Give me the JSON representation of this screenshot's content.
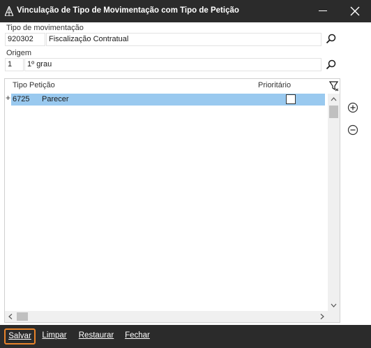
{
  "window": {
    "title": "Vinculação de Tipo de Movimentação com Tipo de Petição",
    "icons": {
      "app": "app-logo-icon",
      "minimize": "minimize-icon",
      "close": "close-icon"
    }
  },
  "movimentacao": {
    "label": "Tipo de movimentação",
    "code": "920302",
    "description": "Fiscalização Contratual",
    "lookup_icon": "search-icon"
  },
  "origem": {
    "label": "Origem",
    "code": "1",
    "description": "1º grau",
    "lookup_icon": "search-icon"
  },
  "grid": {
    "columns": {
      "tipo": "Tipo Petição",
      "prioritario": "Prioritário"
    },
    "filter_icon": "filter-icon",
    "rows": [
      {
        "expander": "+",
        "code": "6725",
        "description": "Parecer",
        "prioritario": false,
        "selected": true
      }
    ]
  },
  "side_actions": {
    "add_icon": "add-row-icon",
    "remove_icon": "remove-row-icon"
  },
  "footer": {
    "save_label": "Salvar",
    "clear_label": "Limpar",
    "restore_label": "Restaurar",
    "close_label": "Fechar"
  },
  "colors": {
    "titlebar": "#2b2b2b",
    "selection": "#99c9ef",
    "focus_outline": "#e8832a"
  }
}
